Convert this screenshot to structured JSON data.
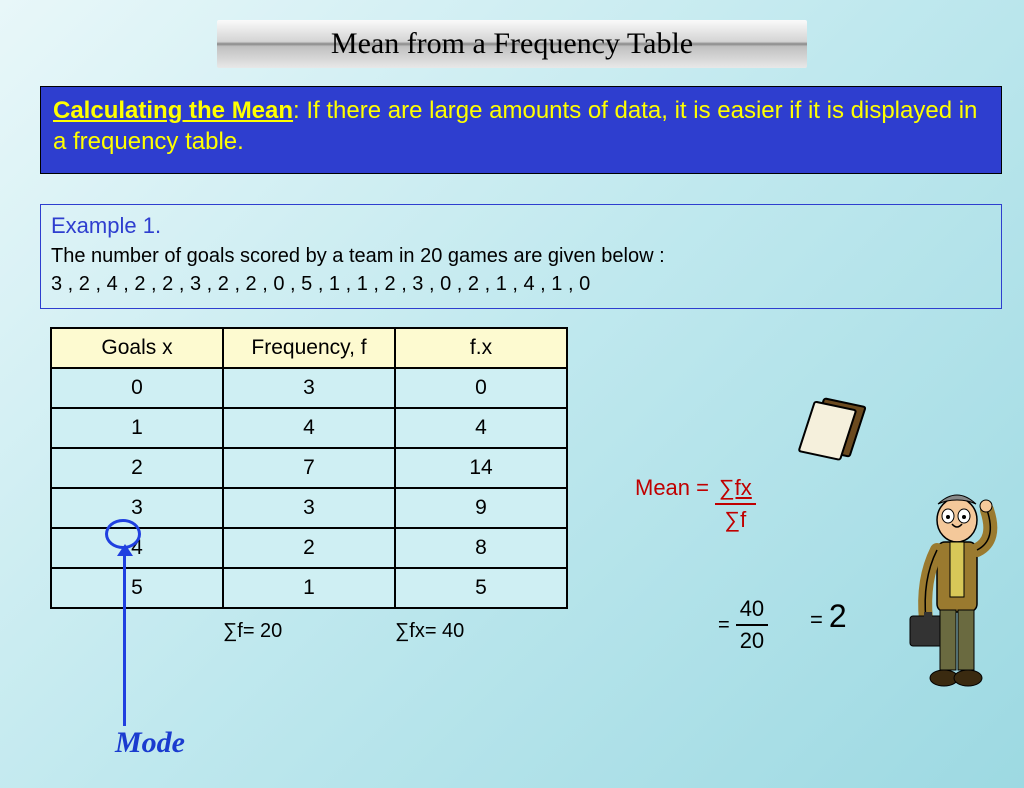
{
  "title": "Mean from a Frequency Table",
  "info": {
    "lead": "Calculating the Mean",
    "rest": ": If there are large amounts of data, it is easier if it is displayed in a frequency table."
  },
  "example": {
    "title": "Example 1.",
    "line1": "The number of goals scored by a team in 20 games are given below :",
    "data": "3 , 2 , 4 , 2 , 2 , 3 , 2 , 2 , 0 , 5 , 1 , 1 , 2 , 3 , 0 , 2 , 1 , 4 , 1 , 0"
  },
  "table": {
    "headers": {
      "x": "Goals  x",
      "f": "Frequency, f",
      "fx": "f.x"
    },
    "rows": [
      {
        "x": "0",
        "f": "3",
        "fx": "0"
      },
      {
        "x": "1",
        "f": "4",
        "fx": "4"
      },
      {
        "x": "2",
        "f": "7",
        "fx": "14"
      },
      {
        "x": "3",
        "f": "3",
        "fx": "9"
      },
      {
        "x": "4",
        "f": "2",
        "fx": "8"
      },
      {
        "x": "5",
        "f": "1",
        "fx": "5"
      }
    ],
    "totals": {
      "sf": "∑f= 20",
      "sfx": "∑fx= 40"
    }
  },
  "mode_label": "Mode",
  "mean": {
    "label": "Mean = ",
    "num": "∑fx",
    "den": "∑f",
    "eq": "=",
    "calc_num": "40",
    "calc_den": "20",
    "result_eq": "=",
    "result": "2"
  },
  "chart_data": {
    "type": "table",
    "title": "Goals frequency table",
    "columns": [
      "Goals x",
      "Frequency f",
      "f·x"
    ],
    "rows": [
      [
        0,
        3,
        0
      ],
      [
        1,
        4,
        4
      ],
      [
        2,
        7,
        14
      ],
      [
        3,
        3,
        9
      ],
      [
        4,
        2,
        8
      ],
      [
        5,
        1,
        5
      ]
    ],
    "sums": {
      "f": 20,
      "fx": 40
    },
    "mean": 2,
    "mode": 2
  }
}
